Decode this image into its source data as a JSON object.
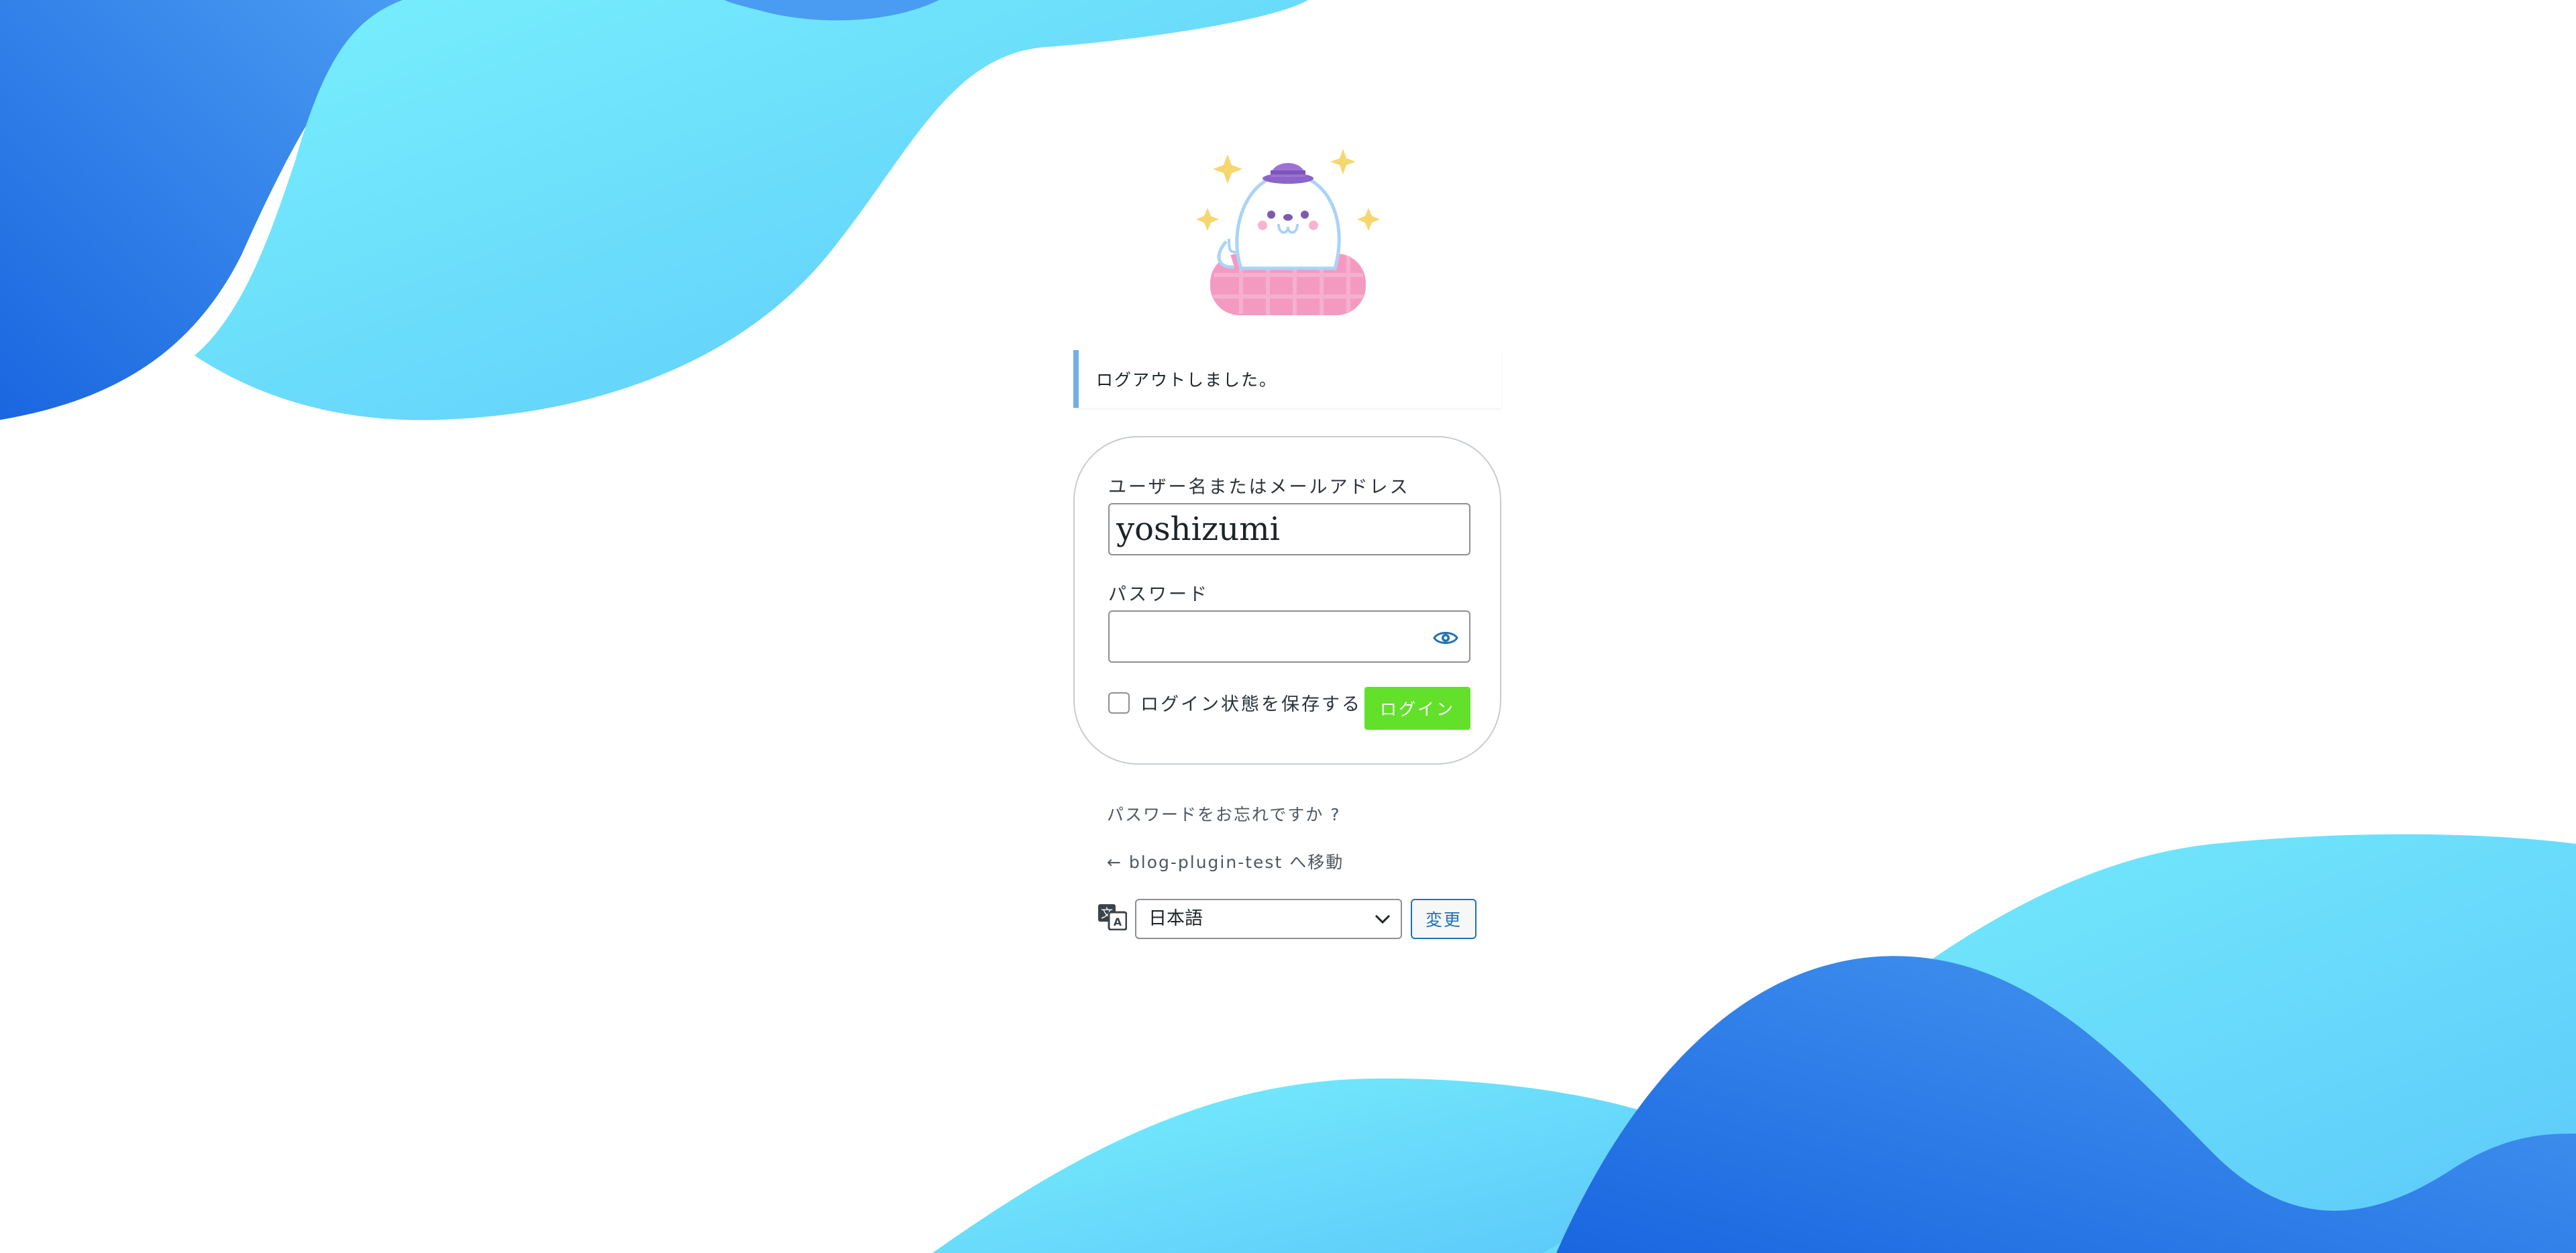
{
  "notice": {
    "message": "ログアウトしました。"
  },
  "login_form": {
    "username_label": "ユーザー名またはメールアドレス",
    "username_value": "yoshizumi",
    "password_label": "パスワード",
    "password_value": "",
    "remember_label": "ログイン状態を保存する",
    "submit_label": "ログイン"
  },
  "links": {
    "lost_password": "パスワードをお忘れですか ?",
    "back_to_site": "← blog-plugin-test へ移動"
  },
  "language": {
    "selected": "日本語",
    "change_label": "変更"
  },
  "colors": {
    "accent_blue": "#2271b1",
    "login_green": "#63e02a",
    "notice_border": "#72aee6",
    "wave_dark": "#1f6fe0",
    "wave_light": "#6ee8fb"
  },
  "icons": {
    "password_toggle": "eye-icon",
    "language": "translate-icon",
    "select": "chevron-down-icon",
    "logo": "seal-mascot-logo"
  }
}
